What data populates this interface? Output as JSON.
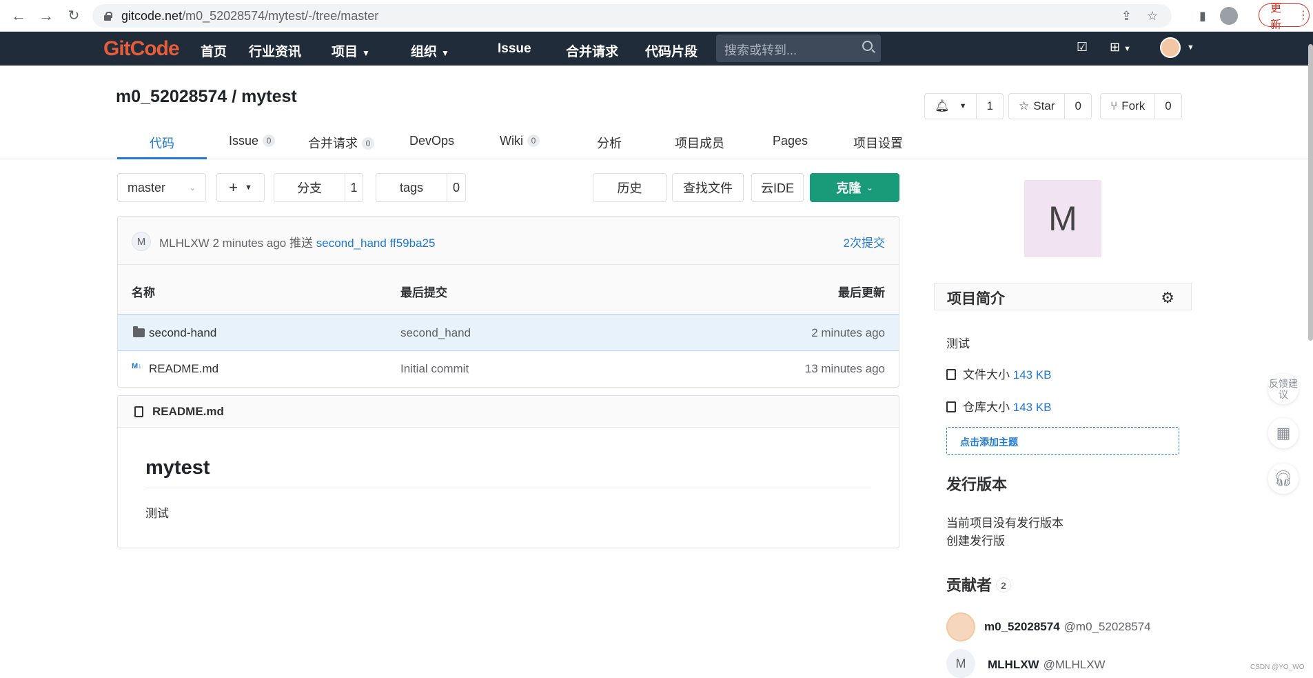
{
  "browser": {
    "url_host": "gitcode.net",
    "url_path": "/m0_52028574/mytest/-/tree/master",
    "update_label": "更新"
  },
  "topnav": {
    "logo": "GitCode",
    "items": [
      "首页",
      "行业资讯",
      "项目",
      "组织",
      "Issue",
      "合并请求",
      "代码片段"
    ],
    "search_placeholder": "搜索或转到..."
  },
  "project": {
    "title": "m0_52028574 / mytest",
    "watch_count": "1",
    "star_label": "Star",
    "star_count": "0",
    "fork_label": "Fork",
    "fork_count": "0"
  },
  "tabs": [
    {
      "label": "代码"
    },
    {
      "label": "Issue",
      "badge": "0"
    },
    {
      "label": "合并请求",
      "badge": "0"
    },
    {
      "label": "DevOps"
    },
    {
      "label": "Wiki",
      "badge": "0"
    },
    {
      "label": "分析"
    },
    {
      "label": "项目成员"
    },
    {
      "label": "Pages"
    },
    {
      "label": "项目设置"
    }
  ],
  "toolbar": {
    "branch": "master",
    "branches_label": "分支",
    "branches_count": "1",
    "tags_label": "tags",
    "tags_count": "0",
    "history": "历史",
    "find_file": "查找文件",
    "cloud_ide": "云IDE",
    "clone": "克隆"
  },
  "last_commit": {
    "avatar_letter": "M",
    "author": "MLHLXW",
    "time": "2 minutes ago",
    "action": "推送",
    "message": "second_hand",
    "sha": "ff59ba25",
    "commits_link": "2次提交"
  },
  "file_table": {
    "headers": [
      "名称",
      "最后提交",
      "最后更新"
    ],
    "rows": [
      {
        "name": "second-hand",
        "commit": "second_hand",
        "updated": "2 minutes ago",
        "type": "folder"
      },
      {
        "name": "README.md",
        "commit": "Initial commit",
        "updated": "13 minutes ago",
        "type": "markdown",
        "icon_text": "M↓"
      }
    ]
  },
  "readme": {
    "filename": "README.md",
    "heading": "mytest",
    "body": "测试"
  },
  "sidebar": {
    "avatar_letter": "M",
    "intro_title": "项目简介",
    "description": "测试",
    "file_size_label": "文件大小",
    "file_size": "143 KB",
    "repo_size_label": "仓库大小",
    "repo_size": "143 KB",
    "add_topic": "点击添加主题",
    "releases_title": "发行版本",
    "no_releases": "当前项目没有发行版本",
    "create_release": "创建发行版",
    "contributors_title": "贡献者",
    "contributors_count": "2",
    "contributors": [
      {
        "name": "m0_52028574",
        "handle": "@m0_52028574"
      },
      {
        "name": "MLHLXW",
        "handle": "@MLHLXW",
        "avatar_letter": "M"
      }
    ]
  },
  "float_tools": {
    "feedback": "反馈建议"
  },
  "watermark": "CSDN @YO_WO"
}
